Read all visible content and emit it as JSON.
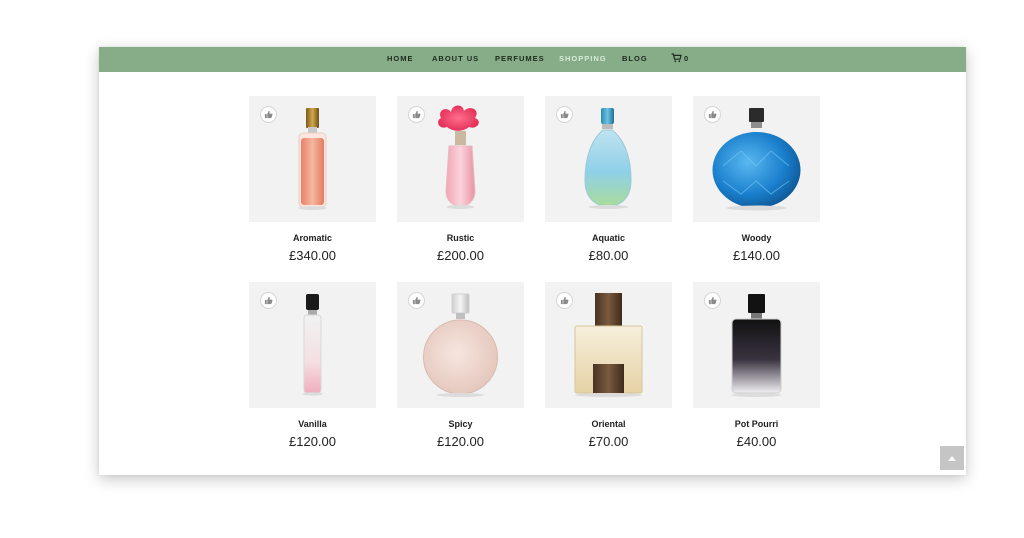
{
  "nav": {
    "faded_text": "",
    "items": [
      {
        "label": "HOME",
        "active": false
      },
      {
        "label": "ABOUT US",
        "active": false
      },
      {
        "label": "PERFUMES",
        "active": false
      },
      {
        "label": "SHOPPING",
        "active": true
      },
      {
        "label": "BLOG",
        "active": false
      }
    ],
    "cart_icon": "shopping-cart-icon",
    "cart_count": "0"
  },
  "colors": {
    "navbar": "#86ad87",
    "active_nav": "#d8ead7",
    "thumb_bg": "#f2f2f2",
    "scroll_button": "#c5c5c5"
  },
  "products": [
    {
      "name": "Aromatic",
      "price": "£340.00"
    },
    {
      "name": "Rustic",
      "price": "£200.00"
    },
    {
      "name": "Aquatic",
      "price": "£80.00"
    },
    {
      "name": "Woody",
      "price": "£140.00"
    },
    {
      "name": "Vanilla",
      "price": "£120.00"
    },
    {
      "name": "Spicy",
      "price": "£120.00"
    },
    {
      "name": "Oriental",
      "price": "£70.00"
    },
    {
      "name": "Pot Pourri",
      "price": "£40.00"
    }
  ],
  "icons": {
    "like": "thumbs-up-icon",
    "scroll_top": "chevron-up-icon"
  }
}
